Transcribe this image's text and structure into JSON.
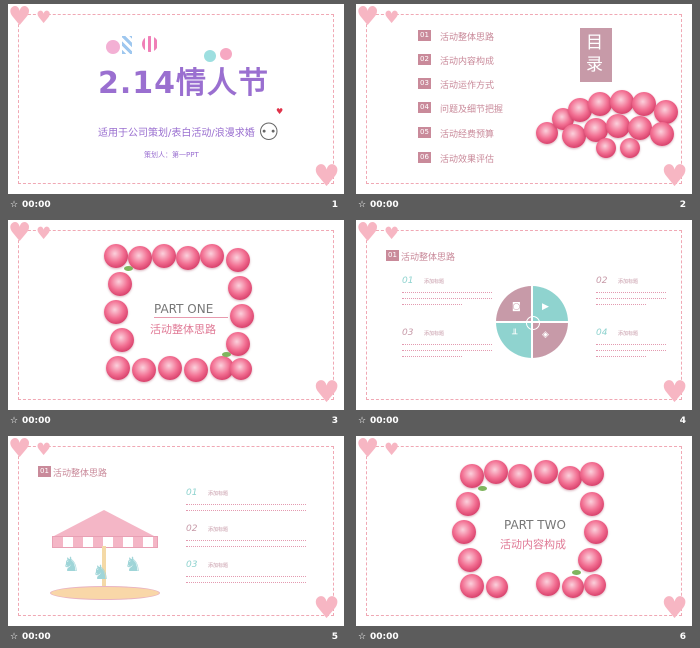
{
  "player": {
    "play_icon": "play-icon",
    "time": "00:00"
  },
  "slides": [
    {
      "num": "1",
      "title": "2.14情人节",
      "subtitle": "适用于公司策划/表白活动/浪漫求婚",
      "author": "策划人：第一PPT"
    },
    {
      "num": "2",
      "toc_title": "目录",
      "items": [
        {
          "n": "01",
          "label": "活动整体思路"
        },
        {
          "n": "02",
          "label": "活动内容构成"
        },
        {
          "n": "03",
          "label": "活动运作方式"
        },
        {
          "n": "04",
          "label": "问题及细节把握"
        },
        {
          "n": "05",
          "label": "活动经费预算"
        },
        {
          "n": "06",
          "label": "活动效果评估"
        }
      ]
    },
    {
      "num": "3",
      "part": "PART ONE",
      "part_sub": "活动整体思路"
    },
    {
      "num": "4",
      "header_n": "01",
      "header": "活动整体思路",
      "blocks": [
        {
          "n": "01",
          "title": "添加标题"
        },
        {
          "n": "02",
          "title": "添加标题"
        },
        {
          "n": "03",
          "title": "添加标题"
        },
        {
          "n": "04",
          "title": "添加标题"
        }
      ]
    },
    {
      "num": "5",
      "header_n": "01",
      "header": "活动整体思路",
      "blocks": [
        {
          "n": "01",
          "title": "添加标题"
        },
        {
          "n": "02",
          "title": "添加标题"
        },
        {
          "n": "03",
          "title": "添加标题"
        }
      ]
    },
    {
      "num": "6",
      "part": "PART TWO",
      "part_sub": "活动内容构成"
    }
  ],
  "colors": {
    "pink": "#f0a8b4",
    "accent": "#c98a9a",
    "teal": "#8fd3cf",
    "mauve": "#c79aa8",
    "bg": "#5c5c5c"
  }
}
